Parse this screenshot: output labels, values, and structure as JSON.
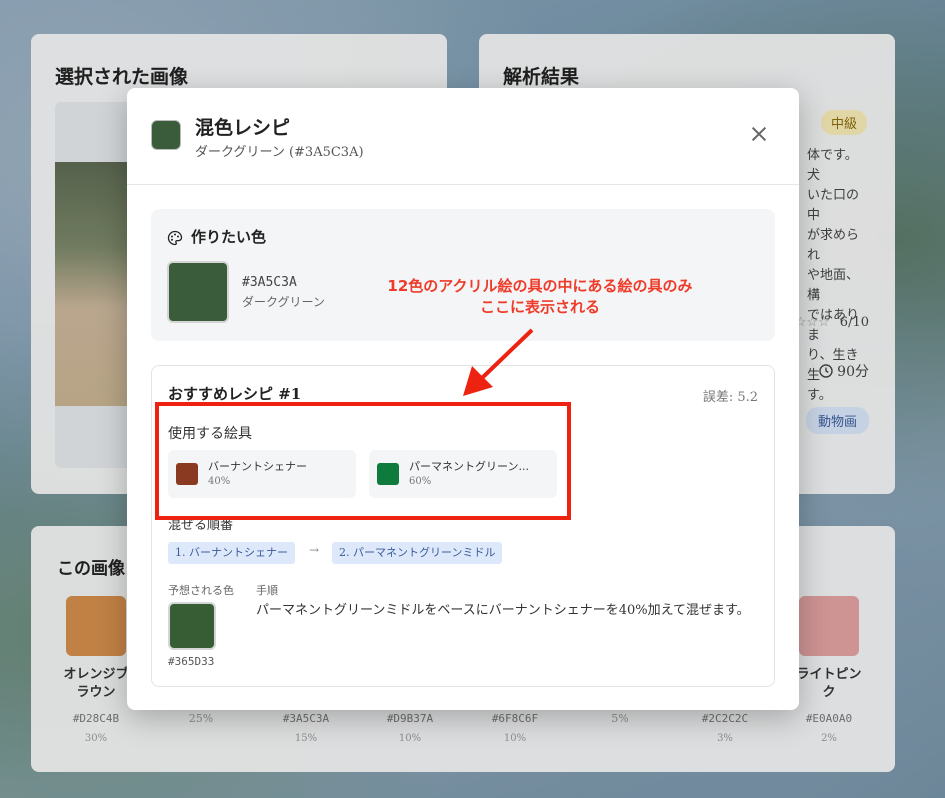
{
  "background": {
    "left_card": {
      "title": "選択された画像"
    },
    "right_card": {
      "title": "解析結果",
      "difficulty_badge": "中級",
      "description_lines": [
        "体です。犬",
        "いた口の中",
        "が求められ",
        "や地面、構",
        "ではありま",
        "り、生き生",
        "す。"
      ],
      "rating_stars": "☆☆☆",
      "rating_value": "6/10",
      "duration": "90分",
      "tag": "動物画"
    },
    "bottom_card": {
      "title": "この画像",
      "colors": [
        {
          "name": "オレンジブラウン",
          "name_lines": [
            "オレンジブ",
            "ラウン"
          ],
          "hex": "#D28C4B",
          "pct": "30%",
          "color": "#D28C4B"
        },
        {
          "name": "",
          "hex": "",
          "pct": "25%"
        },
        {
          "name": "",
          "hex": "#3A5C3A",
          "pct": "15%"
        },
        {
          "name": "",
          "hex": "#D9B37A",
          "pct": "10%"
        },
        {
          "name": "",
          "hex": "#6F8C6F",
          "pct": "10%"
        },
        {
          "name": "",
          "hex": "",
          "pct": "5%"
        },
        {
          "name": "",
          "hex": "#2C2C2C",
          "pct": "3%"
        },
        {
          "name": "ライトピンク",
          "name_lines": [
            "ライトピン",
            "ク"
          ],
          "hex": "#E0A0A0",
          "pct": "2%",
          "color": "#E0A0A0"
        }
      ]
    }
  },
  "modal": {
    "title": "混色レシピ",
    "subtitle": "ダークグリーン (#3A5C3A)",
    "target_color": "#3A5C3A",
    "target": {
      "heading": "作りたい色",
      "hex": "#3A5C3A",
      "name": "ダークグリーン"
    },
    "recipe": {
      "title": "おすすめレシピ #1",
      "error": "誤差: 5.2",
      "paints_label": "使用する絵具",
      "paints": [
        {
          "name": "バーナントシェナー",
          "pct": "40%",
          "color": "#8B3A22"
        },
        {
          "name": "パーマネントグリーン...",
          "pct": "60%",
          "color": "#0E7A3C"
        }
      ],
      "order_label": "混ぜる順番",
      "steps": [
        "1. バーナントシェナー",
        "2. パーマネントグリーンミドル"
      ],
      "step_arrow": "→",
      "expected_label": "予想される色",
      "expected_hex": "#365D33",
      "expected_color": "#365D33",
      "instruction_label": "手順",
      "instruction": "パーマネントグリーンミドルをベースにバーナントシェナーを40%加えて混ぜます。"
    }
  },
  "annotation": {
    "line1": "12色のアクリル絵の具の中にある絵の具のみ",
    "line2": "ここに表示される",
    "color": "#ee2211"
  }
}
